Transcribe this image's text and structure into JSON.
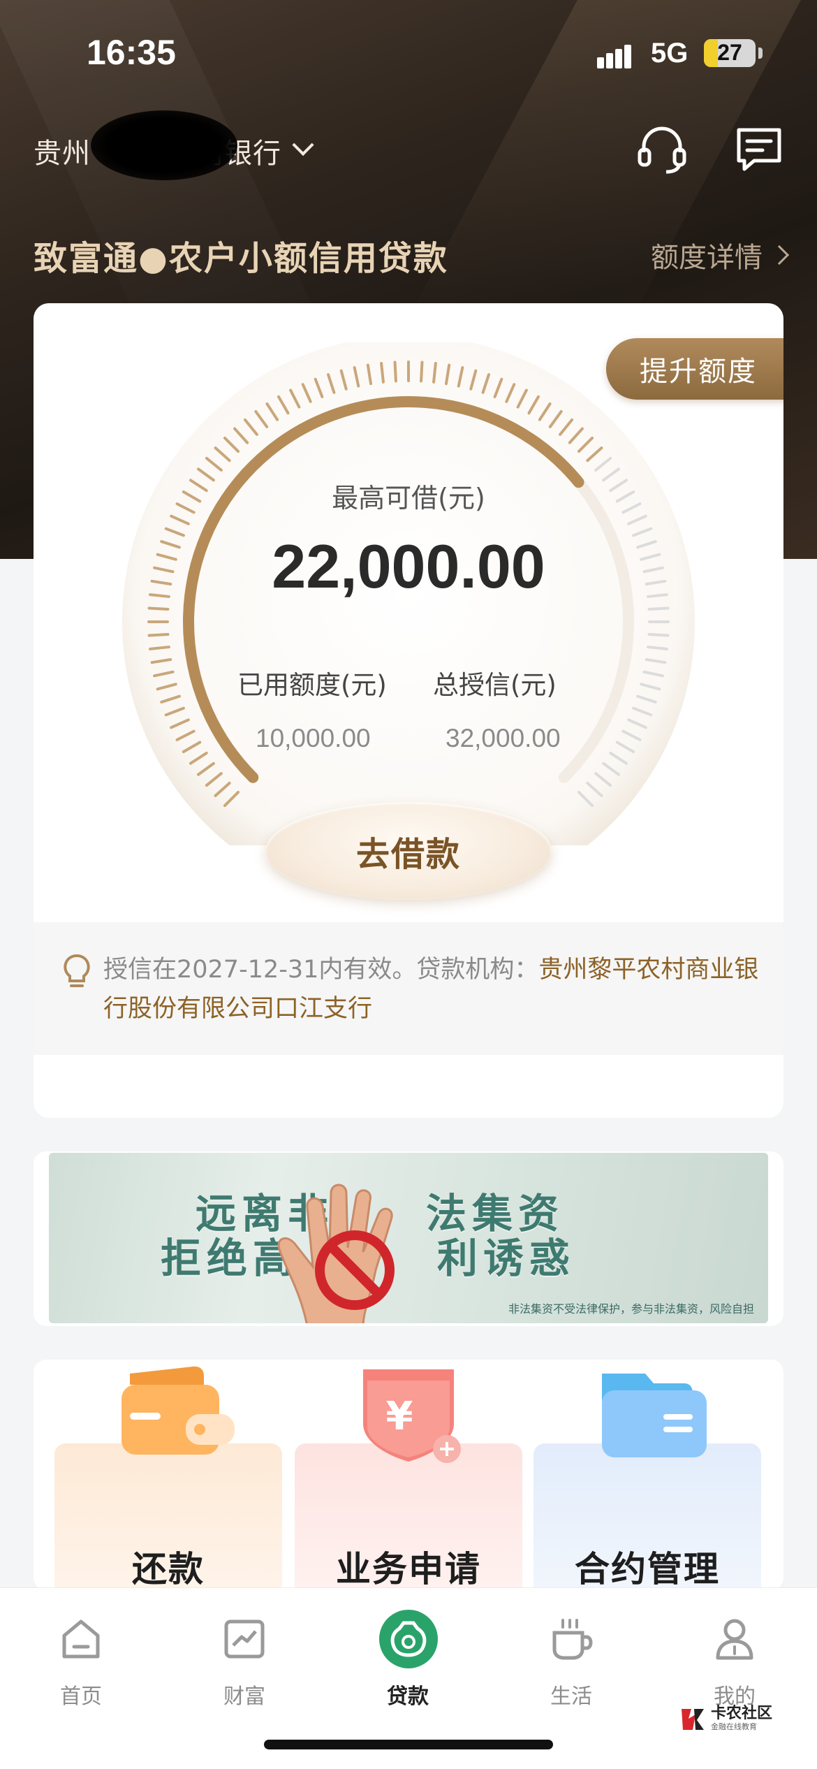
{
  "status_bar": {
    "time": "16:35",
    "network": "5G",
    "battery": "27",
    "battery_level": 0.27
  },
  "header": {
    "bank_name": "贵州",
    "bank_name_tail": "商银行",
    "title": "致富通●农户小额信用贷款",
    "quota_detail": "额度详情"
  },
  "loan": {
    "raise_quota": "提升额度",
    "available_label": "最高可借(元)",
    "available_amount": "22,000.00",
    "used_label": "已用额度(元)",
    "used_amount": "10,000.00",
    "total_label": "总授信(元)",
    "total_amount": "32,000.00",
    "borrow_button": "去借款",
    "used_fraction": 0.3125,
    "notice_prefix": "授信在2027-12-31内有效。贷款机构：",
    "notice_institution": "贵州黎平农村商业银行股份有限公司口江支行"
  },
  "banner": {
    "line1": "远离非　　法集资",
    "line2": "拒绝高　　　利诱惑",
    "small_print": "非法集资不受法律保护，参与非法集资，风险自担"
  },
  "services": [
    {
      "label": "还款",
      "icon": "wallet-icon"
    },
    {
      "label": "业务申请",
      "icon": "shield-yuan-icon"
    },
    {
      "label": "合约管理",
      "icon": "folder-icon"
    }
  ],
  "tab_bar": [
    {
      "label": "首页",
      "icon": "home-icon"
    },
    {
      "label": "财富",
      "icon": "chart-icon"
    },
    {
      "label": "贷款",
      "icon": "loan-icon"
    },
    {
      "label": "生活",
      "icon": "cup-icon"
    },
    {
      "label": "我的",
      "icon": "profile-icon"
    }
  ],
  "watermark": {
    "title": "卡农社区",
    "subtitle": "金融在线教育"
  },
  "colors": {
    "gold": "#b08a5b",
    "accent_green": "#2aa36b",
    "brand_brown": "#7a5326"
  }
}
